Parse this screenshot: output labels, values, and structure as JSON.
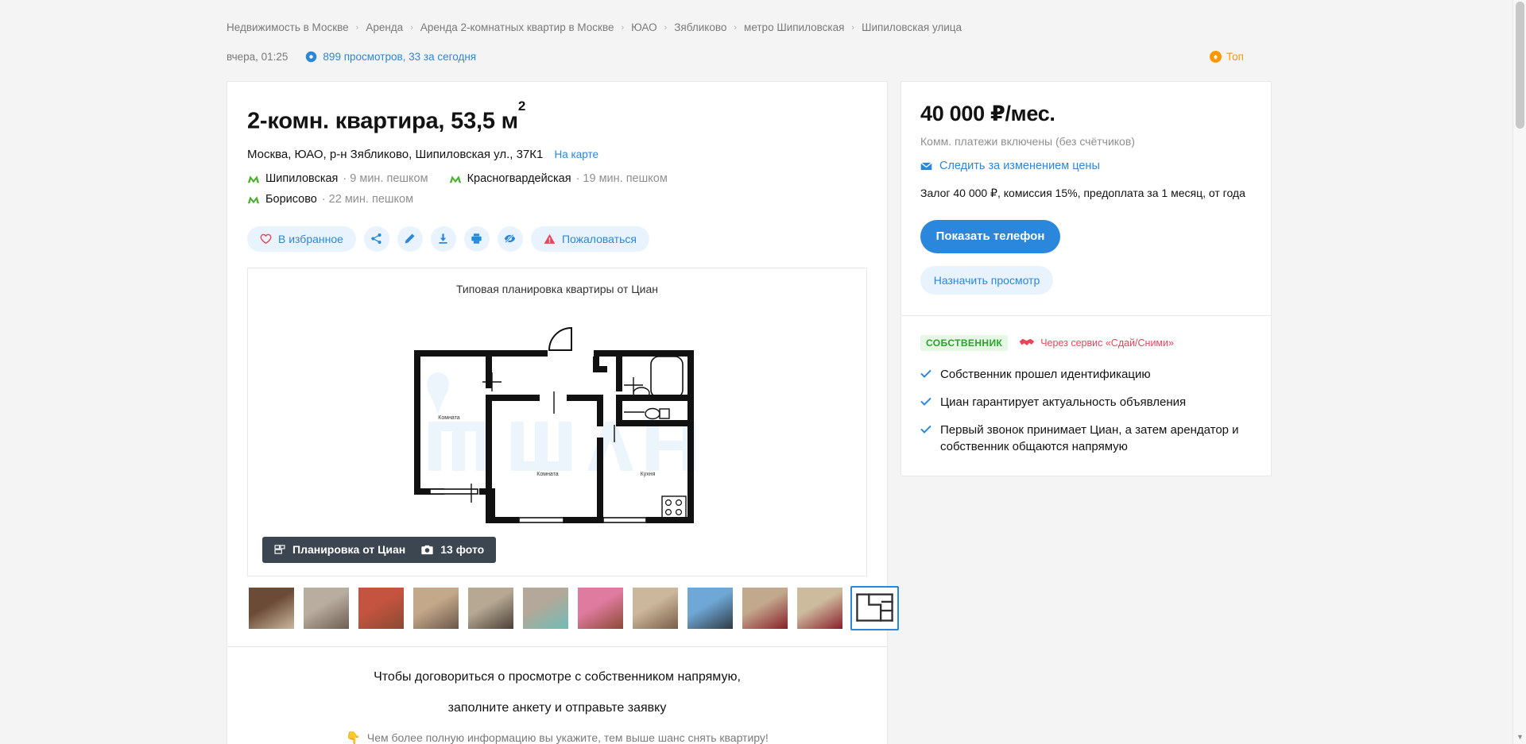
{
  "breadcrumbs": [
    "Недвижимость в Москве",
    "Аренда",
    "Аренда 2-комнатных квартир в Москве",
    "ЮАО",
    "Зябликово",
    "метро Шипиловская",
    "Шипиловская улица"
  ],
  "breadcrumb_separator": "›",
  "meta": {
    "date": "вчера, 01:25",
    "views": "899 просмотров, 33 за сегодня",
    "views_icon": "eye-icon",
    "top_badge": "Топ",
    "top_badge_icon": "arrow-up-circle-icon",
    "top_badge_color": "#ff9800"
  },
  "offer": {
    "title": "2-комн. квартира, 53,5 м",
    "title_sup": "2",
    "address": "Москва, ЮАО, р-н Зябликово, Шипиловская ул., 37К1",
    "map_link": "На карте",
    "metro": [
      {
        "name": "Шипиловская",
        "time": "· 9 мин. пешком",
        "color": "#4caf2e"
      },
      {
        "name": "Красногвардейская",
        "time": "· 19 мин. пешком",
        "color": "#4caf2e"
      },
      {
        "name": "Борисово",
        "time": "· 22 мин. пешком",
        "color": "#4caf2e"
      }
    ],
    "actions": {
      "favorite": "В избранное",
      "favorite_icon": "heart-icon",
      "share_icon": "share-icon",
      "edit_icon": "pencil-icon",
      "download_icon": "download-icon",
      "print_icon": "printer-icon",
      "hide_icon": "eye-off-icon",
      "complain": "Пожаловаться",
      "complain_icon": "warning-triangle-icon"
    }
  },
  "gallery": {
    "caption": "Типовая планировка квартиры от Циан",
    "badge_plan": "Планировка от Циан",
    "badge_plan_icon": "floorplan-icon",
    "badge_photos": "13 фото",
    "badge_photos_icon": "camera-icon",
    "plan_labels": {
      "room1": "Комната",
      "room2": "Комната",
      "kitchen": "Кухня"
    },
    "watermark": "ЦИАН",
    "thumbnails": [
      {
        "name": "room-window",
        "c1": "#6b4a36",
        "c2": "#c9b79d",
        "selected": false
      },
      {
        "name": "living-room",
        "c1": "#b9ada0",
        "c2": "#6d5f52",
        "selected": false
      },
      {
        "name": "hallway-pink",
        "c1": "#c4543f",
        "c2": "#8b4a33",
        "selected": false
      },
      {
        "name": "kitchen-table",
        "c1": "#c4a88a",
        "c2": "#6a584a",
        "selected": false
      },
      {
        "name": "kitchen-cabinets",
        "c1": "#b6a893",
        "c2": "#4a4036",
        "selected": false
      },
      {
        "name": "bathroom",
        "c1": "#b3a899",
        "c2": "#6fbdb6",
        "selected": false
      },
      {
        "name": "corridor-pink",
        "c1": "#e07ba0",
        "c2": "#8c4a36",
        "selected": false
      },
      {
        "name": "toilet",
        "c1": "#cbb79c",
        "c2": "#7a5d46",
        "selected": false
      },
      {
        "name": "window-view",
        "c1": "#6fa8d6",
        "c2": "#2f3a45",
        "selected": false
      },
      {
        "name": "bedroom-door",
        "c1": "#c2a88c",
        "c2": "#8a1f2a",
        "selected": false
      },
      {
        "name": "bedroom-bed",
        "c1": "#cdbb9e",
        "c2": "#8a1f2a",
        "selected": false
      },
      {
        "name": "floorplan-thumb",
        "c1": "#ffffff",
        "c2": "#e9e9e9",
        "selected": true
      }
    ]
  },
  "form_block": {
    "line1": "Чтобы договориться о просмотре с собственником напрямую,",
    "line2": "заполните анкету и отправьте заявку",
    "hint": "Чем более полную информацию вы укажите, тем выше шанс снять квартиру!",
    "hint_icon": "pointing-hand-icon"
  },
  "sidebar": {
    "price": "40 000 ₽/мес.",
    "price_note": "Комм. платежи включены (без счётчиков)",
    "watch_price": "Следить за изменением цены",
    "watch_price_icon": "envelope-icon",
    "deposit": "Залог 40 000 ₽, комиссия 15%, предоплата за 1 месяц, от года",
    "show_phone": "Показать телефон",
    "book_viewing": "Назначить просмотр",
    "owner_tag": "СОБСТВЕННИК",
    "service_text": "Через сервис «Сдай/Сними»",
    "service_icon": "handshake-icon",
    "guarantees": [
      "Собственник прошел идентификацию",
      "Циан гарантирует актуальность объявления",
      "Первый звонок принимает Циан, а затем арендатор и собственник общаются напрямую"
    ],
    "check_icon": "check-icon"
  },
  "colors": {
    "accent": "#2b87db",
    "chip_bg": "#e8f3fd",
    "danger": "#e8455a",
    "success": "#29a329",
    "top": "#ff9800",
    "page_bg": "#f4f4f4"
  }
}
